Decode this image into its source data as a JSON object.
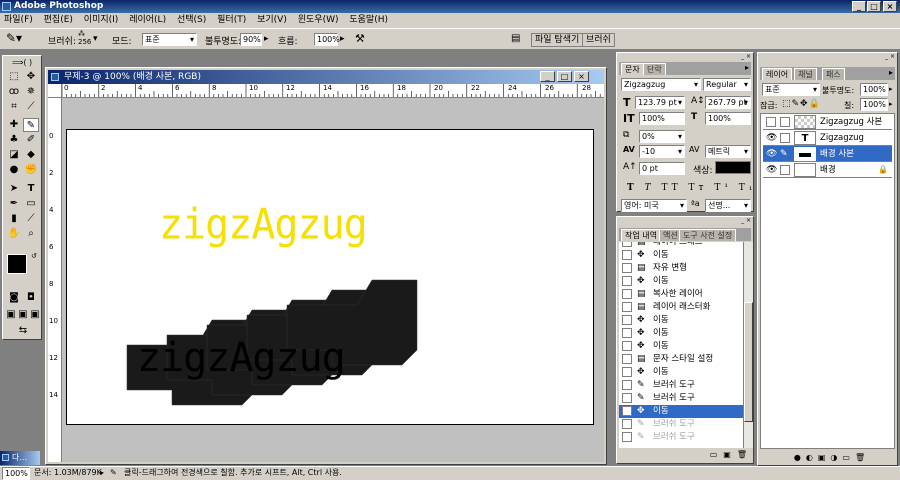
{
  "app_title": "Adobe Photoshop",
  "menu": [
    "파일(F)",
    "편집(E)",
    "이미지(I)",
    "레이어(L)",
    "선택(S)",
    "필터(T)",
    "보기(V)",
    "윈도우(W)",
    "도움말(H)"
  ],
  "options": {
    "brush_label": "브러쉬:",
    "brush_size": "256",
    "mode_label": "모드:",
    "mode_value": "표준",
    "opacity_label": "불투명도:",
    "opacity_value": "90%",
    "flow_label": "흐름:",
    "flow_value": "100%",
    "tab_file_browser": "파일 탐색기",
    "tab_brushes": "브러쉬"
  },
  "document": {
    "title": "무제-3 @ 100% (배경 사본, RGB)",
    "ruler_h": [
      "0",
      "2",
      "4",
      "6",
      "8",
      "10",
      "12",
      "14",
      "16",
      "18",
      "20",
      "22",
      "24",
      "26",
      "28"
    ],
    "ruler_v": [
      "0",
      "2",
      "4",
      "6",
      "8",
      "10",
      "12",
      "14"
    ],
    "yellow_text": "zigzAgzug",
    "dark_text": "zigzAgzug",
    "yellow_color": "#f5e000",
    "dark_color": "#1a1a1a"
  },
  "char_panel": {
    "tab_character": "문자",
    "tab_paragraph": "단락",
    "font_family": "Zigzagzug",
    "font_style": "Regular",
    "font_size": "123.79 pt",
    "leading": "267.79 pt",
    "vertical_scale": "100%",
    "horizontal_scale": "100%",
    "tracking_pct": "0%",
    "kerning": "-10",
    "kerning_mode": "메트릭",
    "baseline": "0 pt",
    "color_label": "색상:",
    "language": "영어: 미국",
    "antialias": "선명..."
  },
  "history_panel": {
    "tab_history": "작업 내역",
    "tab_actions": "액션",
    "tab_presets": "도구 사전 설정",
    "items": [
      {
        "label": "레이어 드래그",
        "icon": "page-icon",
        "state": "normal"
      },
      {
        "label": "이동",
        "icon": "move-icon",
        "state": "normal"
      },
      {
        "label": "자유 변형",
        "icon": "page-icon",
        "state": "normal"
      },
      {
        "label": "이동",
        "icon": "move-icon",
        "state": "normal"
      },
      {
        "label": "복사한 레이어",
        "icon": "page-icon",
        "state": "normal"
      },
      {
        "label": "레이어 래스터화",
        "icon": "page-icon",
        "state": "normal"
      },
      {
        "label": "이동",
        "icon": "move-icon",
        "state": "normal"
      },
      {
        "label": "이동",
        "icon": "move-icon",
        "state": "normal"
      },
      {
        "label": "이동",
        "icon": "move-icon",
        "state": "normal"
      },
      {
        "label": "문자 스타일 설정",
        "icon": "page-icon",
        "state": "normal"
      },
      {
        "label": "이동",
        "icon": "move-icon",
        "state": "normal"
      },
      {
        "label": "브러쉬 도구",
        "icon": "brush-icon",
        "state": "normal"
      },
      {
        "label": "브러쉬 도구",
        "icon": "brush-icon",
        "state": "normal"
      },
      {
        "label": "이동",
        "icon": "move-icon",
        "state": "selected"
      },
      {
        "label": "브러쉬 도구",
        "icon": "brush-icon",
        "state": "dimmed"
      },
      {
        "label": "브러쉬 도구",
        "icon": "brush-icon",
        "state": "dimmed"
      }
    ]
  },
  "layers_panel": {
    "tab_layers": "레이어",
    "tab_channels": "채널",
    "tab_paths": "패스",
    "blend_mode": "표준",
    "opacity_label": "불투명도:",
    "opacity_value": "100%",
    "lock_label": "잠금:",
    "fill_label": "칠:",
    "fill_value": "100%",
    "layers": [
      {
        "name": "Zigzagzug 사본",
        "selected": false
      },
      {
        "name": "Zigzagzug",
        "selected": false
      },
      {
        "name": "배경 사본",
        "selected": true
      },
      {
        "name": "배경",
        "selected": false
      }
    ]
  },
  "status": {
    "zoom": "100%",
    "doc_info": "문서: 1.03M/879K",
    "hint": "클릭-드래그하여 전경색으로 칠함. 추가로 시프트, Alt, Ctrl 사용."
  },
  "minimized_doc": "다..."
}
